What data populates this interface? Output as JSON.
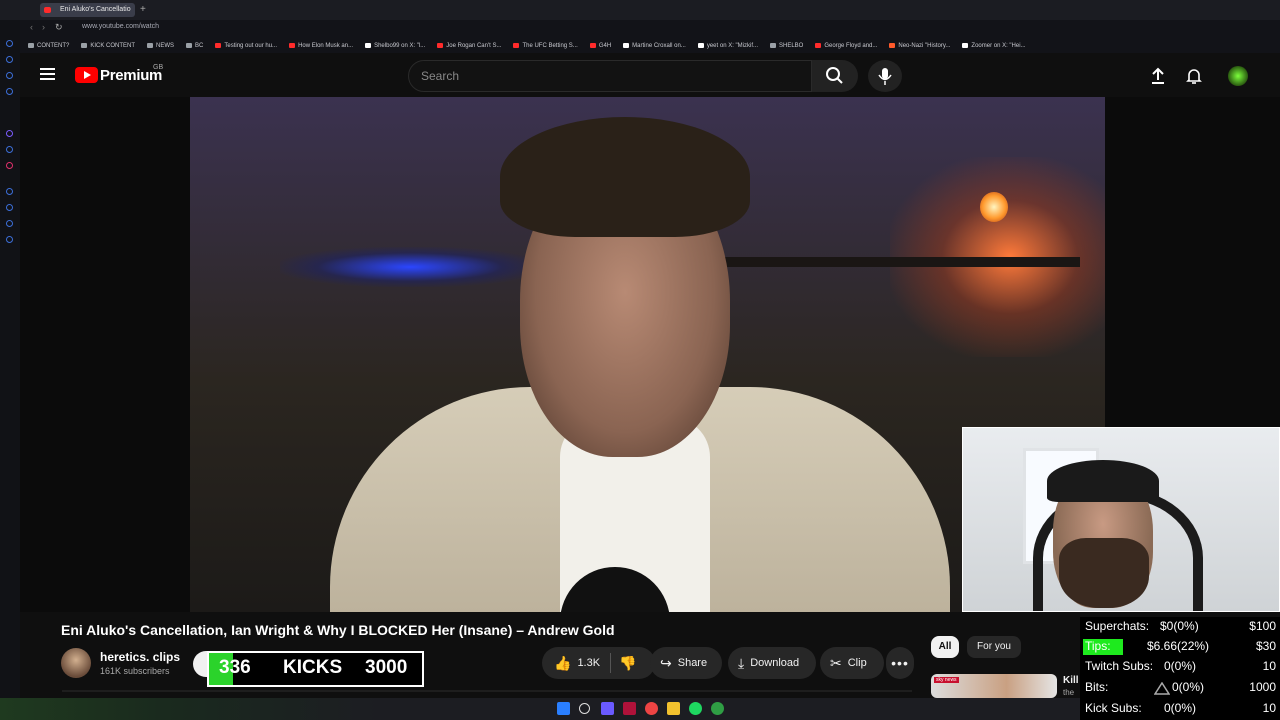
{
  "browser": {
    "tab_title": "Eni Aluko's Cancellatio",
    "url": "www.youtube.com/watch",
    "bookmarks": [
      {
        "label": "CONTENT?",
        "color": "#9aa0a6"
      },
      {
        "label": "KICK CONTENT",
        "color": "#9aa0a6"
      },
      {
        "label": "NEWS",
        "color": "#9aa0a6"
      },
      {
        "label": "BC",
        "color": "#9aa0a6"
      },
      {
        "label": "Testing out our hu...",
        "color": "#ff2b2b"
      },
      {
        "label": "How Elon Musk an...",
        "color": "#ff2b2b"
      },
      {
        "label": "Shelbo99 on X: \"l...",
        "color": "#ffffff"
      },
      {
        "label": "Joe Rogan Can't S...",
        "color": "#ff2b2b"
      },
      {
        "label": "The UFC Betting S...",
        "color": "#ff2b2b"
      },
      {
        "label": "G4H",
        "color": "#ff2b2b"
      },
      {
        "label": "Martine Croxall on...",
        "color": "#ffffff"
      },
      {
        "label": "yeet on X: \"Mizkif...",
        "color": "#ffffff"
      },
      {
        "label": "SHELBO",
        "color": "#9aa0a6"
      },
      {
        "label": "George Floyd and...",
        "color": "#ff2b2b"
      },
      {
        "label": "Neo-Nazi \"History...",
        "color": "#ff5a2b"
      },
      {
        "label": "Zoomer on X: \"Hei...",
        "color": "#ffffff"
      }
    ]
  },
  "header": {
    "logo_text": "Premium",
    "region": "GB",
    "search_placeholder": "Search"
  },
  "video": {
    "title": "Eni Aluko's Cancellation, Ian Wright & Why I BLOCKED Her (Insane) – Andrew Gold",
    "channel": "heretics. clips",
    "subscribers": "161K subscribers",
    "likes": "1.3K",
    "share_label": "Share",
    "download_label": "Download",
    "clip_label": "Clip"
  },
  "kicks_widget": {
    "current": "336",
    "label": "KICKS",
    "goal": "3000",
    "progress_fraction": 0.112
  },
  "sidebar": {
    "chips": [
      "All",
      "For you"
    ],
    "rec_title": "Kill",
    "rec_title2": "the",
    "thumb_tag": "sky news"
  },
  "stats": [
    {
      "label": "Superchats:",
      "value": "$0(0%)",
      "goal": "$100"
    },
    {
      "label": "Tips:",
      "value": "$6.66(22%)",
      "goal": "$30"
    },
    {
      "label": "Twitch Subs:",
      "value": "0(0%)",
      "goal": "10"
    },
    {
      "label": "Bits:",
      "value": "0(0%)",
      "goal": "1000"
    },
    {
      "label": "Kick Subs:",
      "value": "0(0%)",
      "goal": "10"
    }
  ],
  "colors": {
    "yt_red": "#ff0000",
    "tips_highlight": "#1eea1e",
    "kicks_fill": "#2bd32b"
  }
}
